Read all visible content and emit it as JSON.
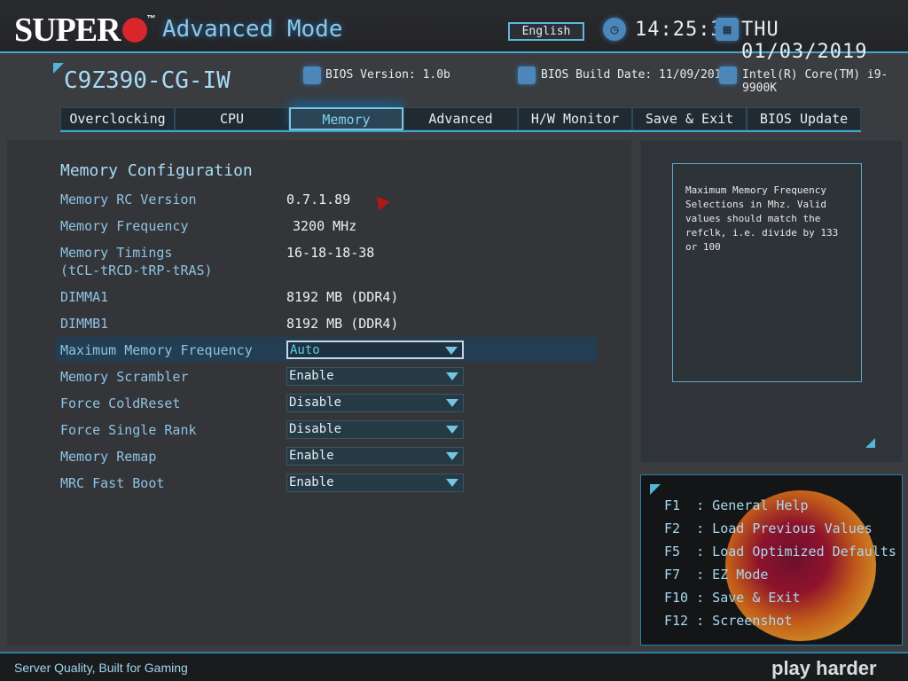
{
  "header": {
    "logo_text": "SUPER",
    "title": "Advanced Mode",
    "language": "English",
    "time": "14:25:38",
    "date": "THU 01/03/2019"
  },
  "system": {
    "model": "C9Z390-CG-IW",
    "bios_version": "BIOS Version: 1.0b",
    "build_date": "BIOS Build Date: 11/09/2018",
    "cpu": "Intel(R) Core(TM) i9-9900K"
  },
  "tabs": [
    {
      "label": "Overclocking"
    },
    {
      "label": "CPU"
    },
    {
      "label": "Memory",
      "active": true
    },
    {
      "label": "Advanced"
    },
    {
      "label": "H/W Monitor"
    },
    {
      "label": "Save & Exit"
    },
    {
      "label": "BIOS Update"
    }
  ],
  "main": {
    "heading": "Memory Configuration",
    "info": [
      {
        "label": "Memory RC Version",
        "value": "0.7.1.89"
      },
      {
        "label": "Memory Frequency",
        "value": "3200 MHz"
      },
      {
        "label": "Memory Timings",
        "label2": "(tCL-tRCD-tRP-tRAS)",
        "value": "16-18-18-38"
      },
      {
        "label": "DIMMA1",
        "value": "8192 MB (DDR4)"
      },
      {
        "label": "DIMMB1",
        "value": "8192 MB (DDR4)"
      }
    ],
    "settings": [
      {
        "label": "Maximum Memory Frequency",
        "value": "Auto"
      },
      {
        "label": "Memory Scrambler",
        "value": "Enable"
      },
      {
        "label": "Force ColdReset",
        "value": "Disable"
      },
      {
        "label": "Force Single Rank",
        "value": "Disable"
      },
      {
        "label": "Memory Remap",
        "value": "Enable"
      },
      {
        "label": "MRC Fast Boot",
        "value": "Enable"
      }
    ]
  },
  "help": {
    "text": "Maximum Memory Frequency Selections in Mhz. Valid values should match the refclk, i.e. divide by 133 or 100"
  },
  "keys": [
    {
      "text": "F1  : General Help"
    },
    {
      "text": "F2  : Load Previous Values"
    },
    {
      "text": "F5  : Load Optimized Defaults"
    },
    {
      "text": "F7  : EZ Mode"
    },
    {
      "text": "F10 : Save & Exit"
    },
    {
      "text": "F12 : Screenshot"
    }
  ],
  "footer": {
    "tagline": "Server Quality, Built for Gaming",
    "slogan": "play harder"
  }
}
